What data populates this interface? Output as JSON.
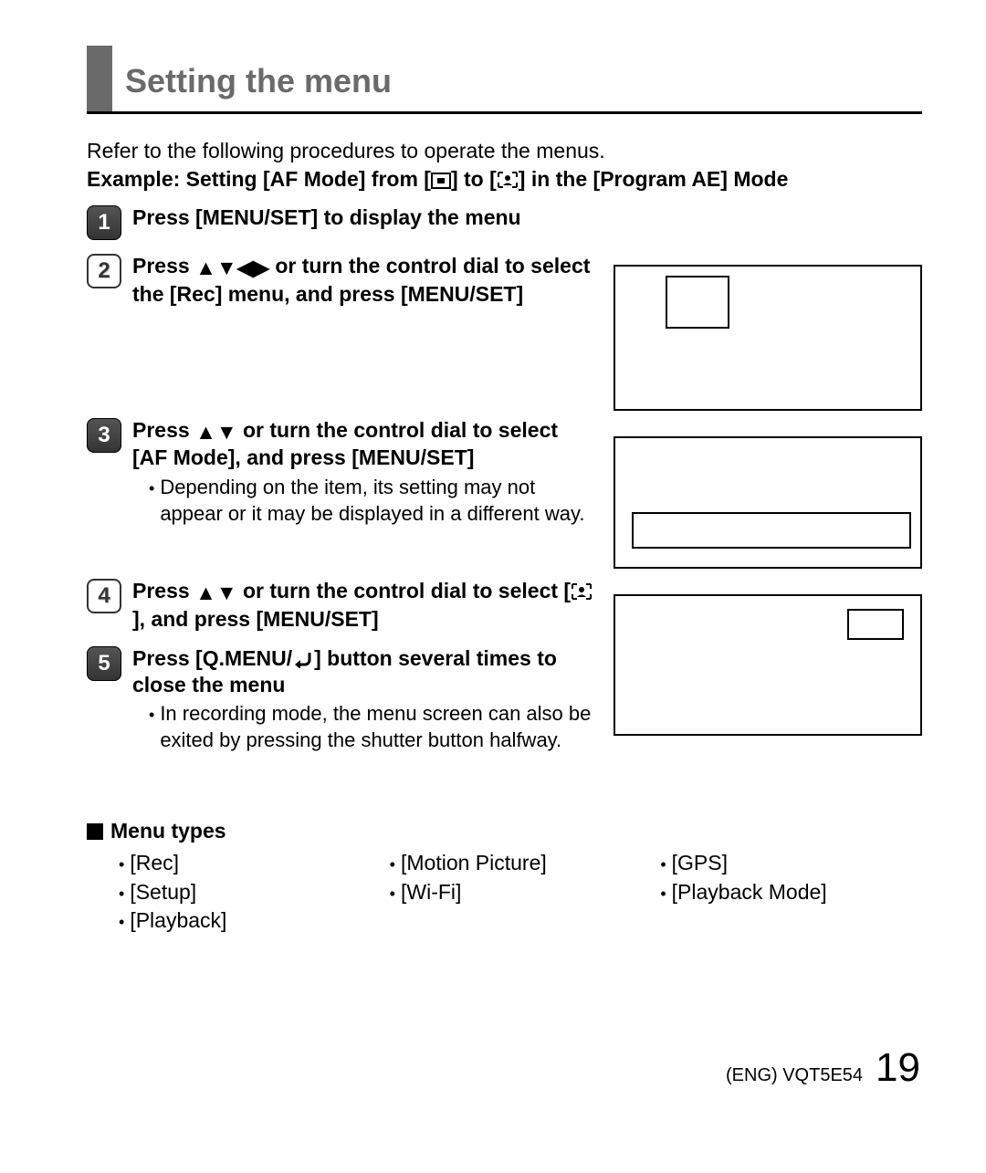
{
  "page_title": "Setting the menu",
  "intro_line": "Refer to the following procedures to operate the menus.",
  "example_prefix": "Example: Setting [AF Mode] from [",
  "example_mid": "] to [",
  "example_suffix": "] in the [Program AE] Mode",
  "steps": {
    "s1": {
      "num": "1",
      "title": "Press [MENU/SET] to display the menu"
    },
    "s2": {
      "num": "2",
      "title_p1": "Press ",
      "title_p2": " or turn the control dial to select the [Rec] menu, and press [MENU/SET]"
    },
    "s3": {
      "num": "3",
      "title_p1": "Press ",
      "title_p2": " or turn the control dial to select [AF Mode], and press [MENU/SET]",
      "note": "Depending on the item, its setting may not appear or it may be displayed in a different way."
    },
    "s4": {
      "num": "4",
      "title_p1": "Press ",
      "title_p2": " or turn the control dial to select [",
      "title_p3": "], and press [MENU/SET]"
    },
    "s5": {
      "num": "5",
      "title_p1": "Press [Q.MENU/",
      "title_p2": "] button several times to close the menu",
      "note": "In recording mode, the menu screen can also be exited by pressing the shutter button halfway."
    }
  },
  "menu_types_head": "Menu types",
  "menu_types": {
    "col1": [
      "[Rec]",
      "[Setup]",
      "[Playback]"
    ],
    "col2": [
      "[Motion Picture]",
      "[Wi-Fi]"
    ],
    "col3": [
      "[GPS]",
      "[Playback Mode]"
    ]
  },
  "footer_code": "(ENG) VQT5E54",
  "footer_page": "19"
}
